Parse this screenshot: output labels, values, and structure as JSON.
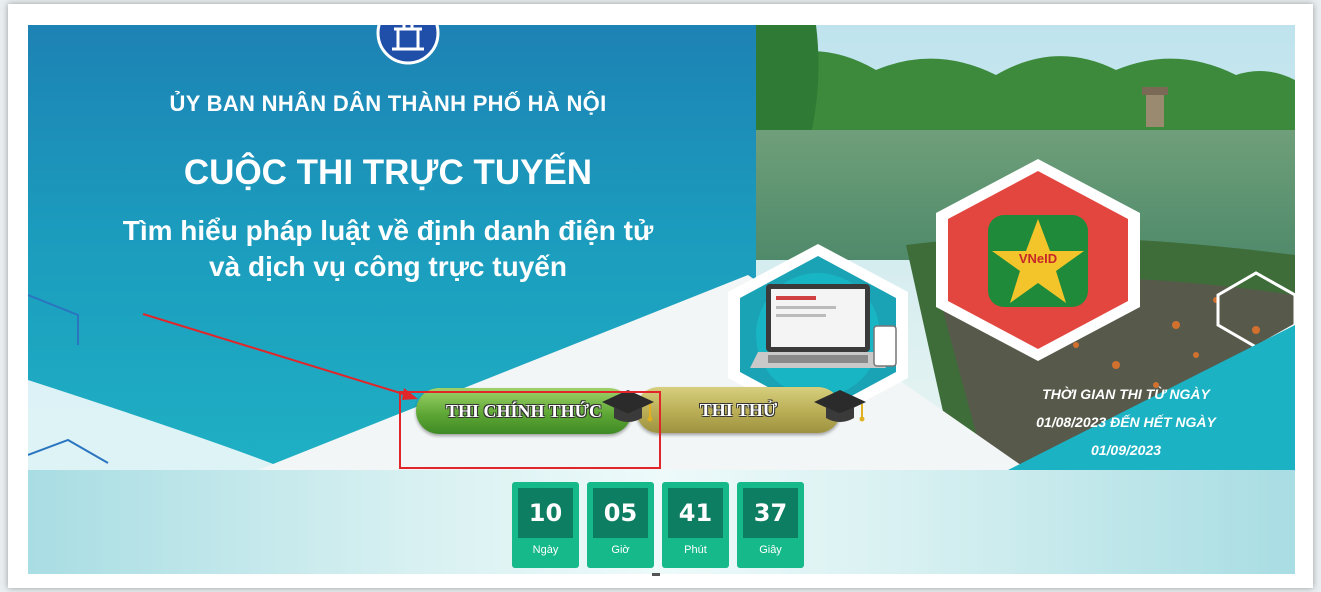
{
  "banner": {
    "organization": "ỦY BAN NHÂN DÂN THÀNH PHỐ HÀ NỘI",
    "contest_title": "CUỘC THI TRỰC TUYẾN",
    "subtitle_line1": "Tìm hiểu pháp luật về định danh điện tử",
    "subtitle_line2": "và dịch vụ công trực tuyến",
    "vneid_label": "VNeID"
  },
  "schedule": {
    "line1": "THỜI GIAN THI TỪ NGÀY",
    "line2": "01/08/2023 ĐẾN HẾT NGÀY",
    "line3": "01/09/2023"
  },
  "buttons": {
    "official": "THI CHÍNH THỨC",
    "trial": "THI THỬ"
  },
  "countdown": [
    {
      "value": "10",
      "label": "Ngày"
    },
    {
      "value": "05",
      "label": "Giờ"
    },
    {
      "value": "41",
      "label": "Phút"
    },
    {
      "value": "37",
      "label": "Giây"
    }
  ],
  "colors": {
    "highlight": "#e0262b",
    "countdown_tile": "#16b98a",
    "countdown_number_bg": "#0e7e62"
  }
}
